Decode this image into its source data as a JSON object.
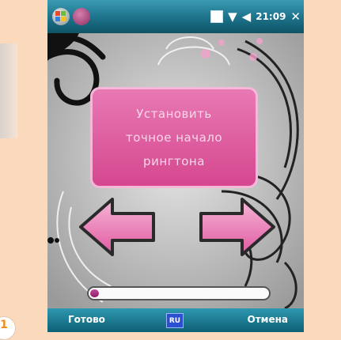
{
  "status_bar": {
    "clock": "21:09",
    "icons": [
      "windows-start-icon",
      "app-icon",
      "connection-icon",
      "signal-icon",
      "volume-icon",
      "close-icon"
    ]
  },
  "message": {
    "line1": "Установить",
    "line2": "точное начало",
    "line3": "рингтона"
  },
  "progress": {
    "fraction": 0.05
  },
  "softkeys": {
    "left": "Готово",
    "input": "RU",
    "right": "Отмена"
  },
  "colors": {
    "accent_pink": "#e36aa9",
    "title_bar": "#1c7189",
    "page_bg": "#fbd9bd"
  },
  "page_marker": "1"
}
